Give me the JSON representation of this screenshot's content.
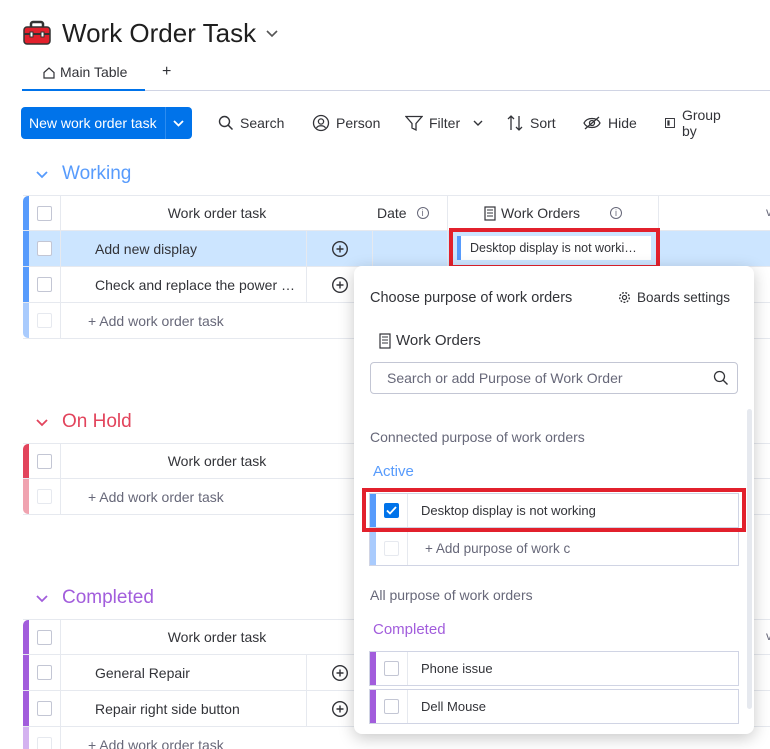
{
  "header": {
    "title": "Work Order Task"
  },
  "tabs": {
    "main": "Main Table",
    "add": "+"
  },
  "toolbar": {
    "new_item": "New work order task",
    "search": "Search",
    "person": "Person",
    "filter": "Filter",
    "sort": "Sort",
    "hide": "Hide",
    "group_by": "Group by"
  },
  "columns": {
    "task": "Work order task",
    "date": "Date",
    "work_orders": "Work Orders"
  },
  "groups": [
    {
      "title": "Working",
      "color": "#579bfc",
      "items": [
        "Add new display",
        "Check and replace the power …"
      ],
      "add_label": "+ Add work order task"
    },
    {
      "title": "On Hold",
      "color": "#e2445c",
      "items": [],
      "add_label": "+ Add work order task"
    },
    {
      "title": "Completed",
      "color": "#a25ddc",
      "items": [
        "General Repair",
        "Repair right side button"
      ],
      "add_label": "+ Add work order task"
    }
  ],
  "work_order_chip": "Desktop display is not worki…",
  "popup": {
    "title": "Choose purpose of work orders",
    "settings": "Boards settings",
    "board_name": "Work Orders",
    "search_placeholder": "Search or add Purpose of Work Order",
    "connected_label": "Connected purpose of work orders",
    "active_group": "Active",
    "connected_item": "Desktop display is not working",
    "add_purpose": "+ Add purpose of work c",
    "all_label": "All purpose of work orders",
    "completed_group": "Completed",
    "items": [
      "Phone issue",
      "Dell Mouse"
    ]
  },
  "colors": {
    "accent": "#0073ea",
    "working": "#579bfc",
    "on_hold": "#e2445c",
    "completed": "#a25ddc",
    "highlight": "#e2202c"
  }
}
